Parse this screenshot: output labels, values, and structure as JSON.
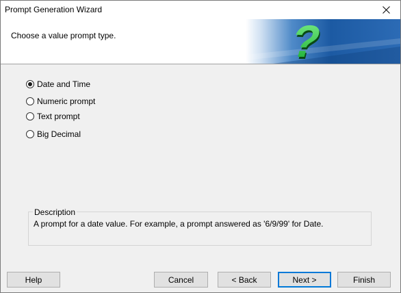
{
  "window": {
    "title": "Prompt Generation Wizard"
  },
  "header": {
    "instruction": "Choose a value prompt type."
  },
  "options": [
    {
      "label": "Date and Time",
      "checked": true
    },
    {
      "label": "Numeric prompt",
      "checked": false
    },
    {
      "label": "Text prompt",
      "checked": false
    },
    {
      "label": "Big Decimal",
      "checked": false
    }
  ],
  "description": {
    "legend": "Description",
    "text": "A prompt for a date value.  For example, a prompt answered as '6/9/99' for Date."
  },
  "buttons": {
    "help": "Help",
    "cancel": "Cancel",
    "back": "< Back",
    "next": "Next >",
    "finish": "Finish"
  },
  "icons": {
    "close": "close-icon",
    "header_graphic": "question-mark-graphic"
  },
  "colors": {
    "accent": "#0078d7",
    "question_green": "#22c23a",
    "header_blue": "#1d5fa6"
  }
}
